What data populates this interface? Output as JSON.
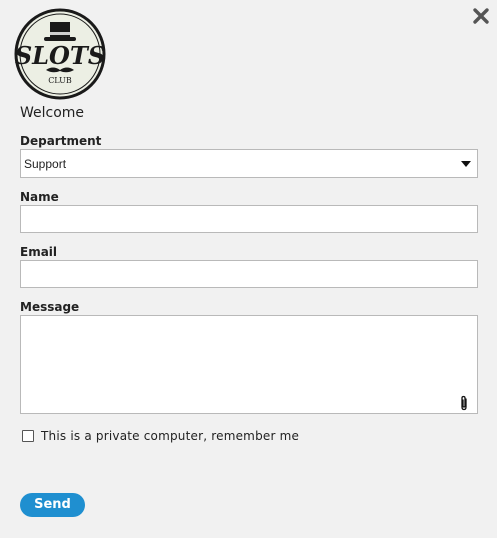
{
  "header": {
    "logo_text": "SLOTS",
    "logo_subtext": "CLUB",
    "close_icon": "close-icon"
  },
  "form": {
    "welcome": "Welcome",
    "department": {
      "label": "Department",
      "selected": "Support"
    },
    "name": {
      "label": "Name",
      "value": ""
    },
    "email": {
      "label": "Email",
      "value": ""
    },
    "message": {
      "label": "Message",
      "value": "",
      "attach_icon": "paperclip-icon"
    },
    "remember": {
      "label": "This is a private computer, remember me",
      "checked": false
    },
    "send_label": "Send"
  },
  "colors": {
    "background": "#f1f1f1",
    "accent": "#1f8fd0",
    "border": "#b9b9b9",
    "logo_bg": "#ecefe4",
    "logo_ring": "#1a1a1a"
  }
}
